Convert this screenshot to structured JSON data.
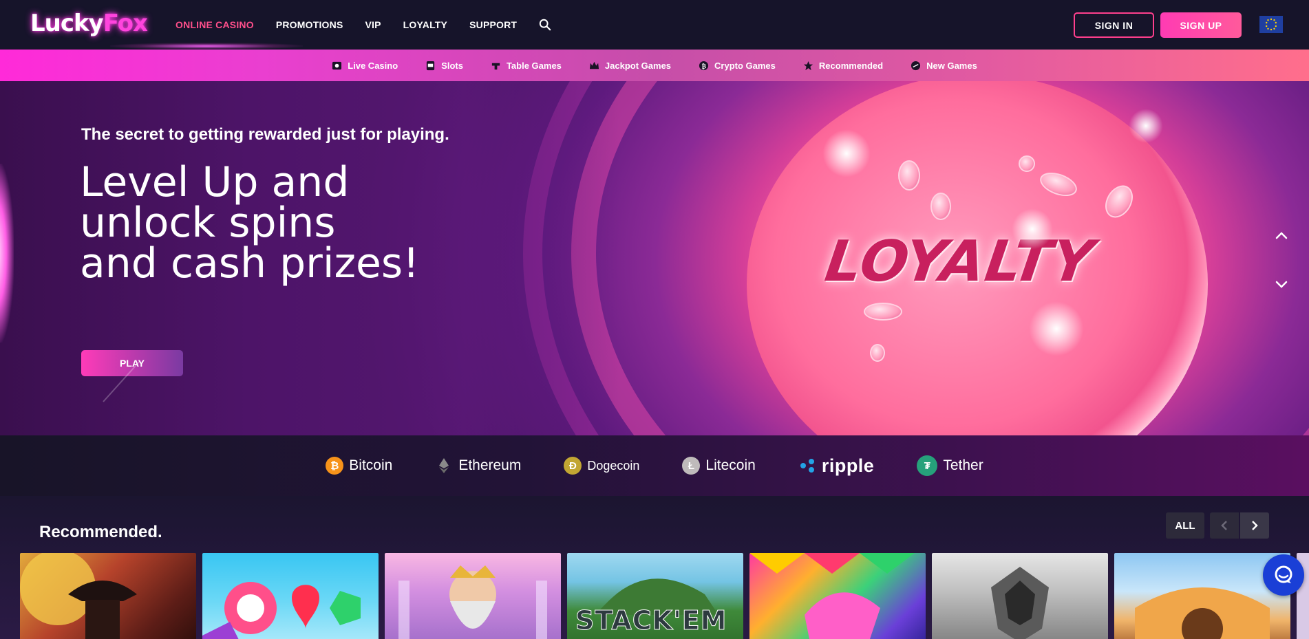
{
  "header": {
    "logo_part1": "Lucky",
    "logo_part2": "Fox",
    "nav": [
      {
        "label": "ONLINE CASINO",
        "active": true
      },
      {
        "label": "PROMOTIONS",
        "active": false
      },
      {
        "label": "VIP",
        "active": false
      },
      {
        "label": "LOYALTY",
        "active": false
      },
      {
        "label": "SUPPORT",
        "active": false
      }
    ],
    "sign_in": "SIGN IN",
    "sign_up": "SIGN UP",
    "language_icon": "eu-flag-icon"
  },
  "categories": [
    {
      "label": "Live Casino",
      "icon": "live-casino-icon"
    },
    {
      "label": "Slots",
      "icon": "slots-icon"
    },
    {
      "label": "Table Games",
      "icon": "table-games-icon"
    },
    {
      "label": "Jackpot Games",
      "icon": "jackpot-icon"
    },
    {
      "label": "Crypto Games",
      "icon": "crypto-icon"
    },
    {
      "label": "Recommended",
      "icon": "star-icon"
    },
    {
      "label": "New Games",
      "icon": "new-games-icon"
    }
  ],
  "hero": {
    "subtitle": "The secret to getting rewarded just for playing.",
    "title_lines": [
      "Level Up and",
      "unlock spins",
      "and cash prizes!"
    ],
    "play": "PLAY",
    "image_text": "LOYALTY"
  },
  "crypto": [
    {
      "label": "Bitcoin",
      "symbol": "₿",
      "color": "#f7931a"
    },
    {
      "label": "Ethereum",
      "symbol": "◆",
      "color": "#6b6b6b"
    },
    {
      "label": "Dogecoin",
      "symbol": "Ð",
      "color": "#c2a633"
    },
    {
      "label": "Litecoin",
      "symbol": "Ł",
      "color": "#bfbbbb"
    },
    {
      "label": "ripple",
      "symbol": "",
      "color": "#23a3e6"
    },
    {
      "label": "Tether",
      "symbol": "₮",
      "color": "#26a17b"
    }
  ],
  "recommended": {
    "title": "Recommended.",
    "all": "ALL",
    "tiles": [
      {
        "name": "game-tile-1",
        "text": ""
      },
      {
        "name": "game-tile-2",
        "text": ""
      },
      {
        "name": "game-tile-3",
        "text": ""
      },
      {
        "name": "game-tile-4",
        "text": "STACK'EM"
      },
      {
        "name": "game-tile-5",
        "text": ""
      },
      {
        "name": "game-tile-6",
        "text": ""
      },
      {
        "name": "game-tile-7",
        "text": ""
      }
    ]
  },
  "colors": {
    "accent": "#ff3f8d",
    "active_nav": "#ff4f8b",
    "chat": "#1a3fd6"
  }
}
